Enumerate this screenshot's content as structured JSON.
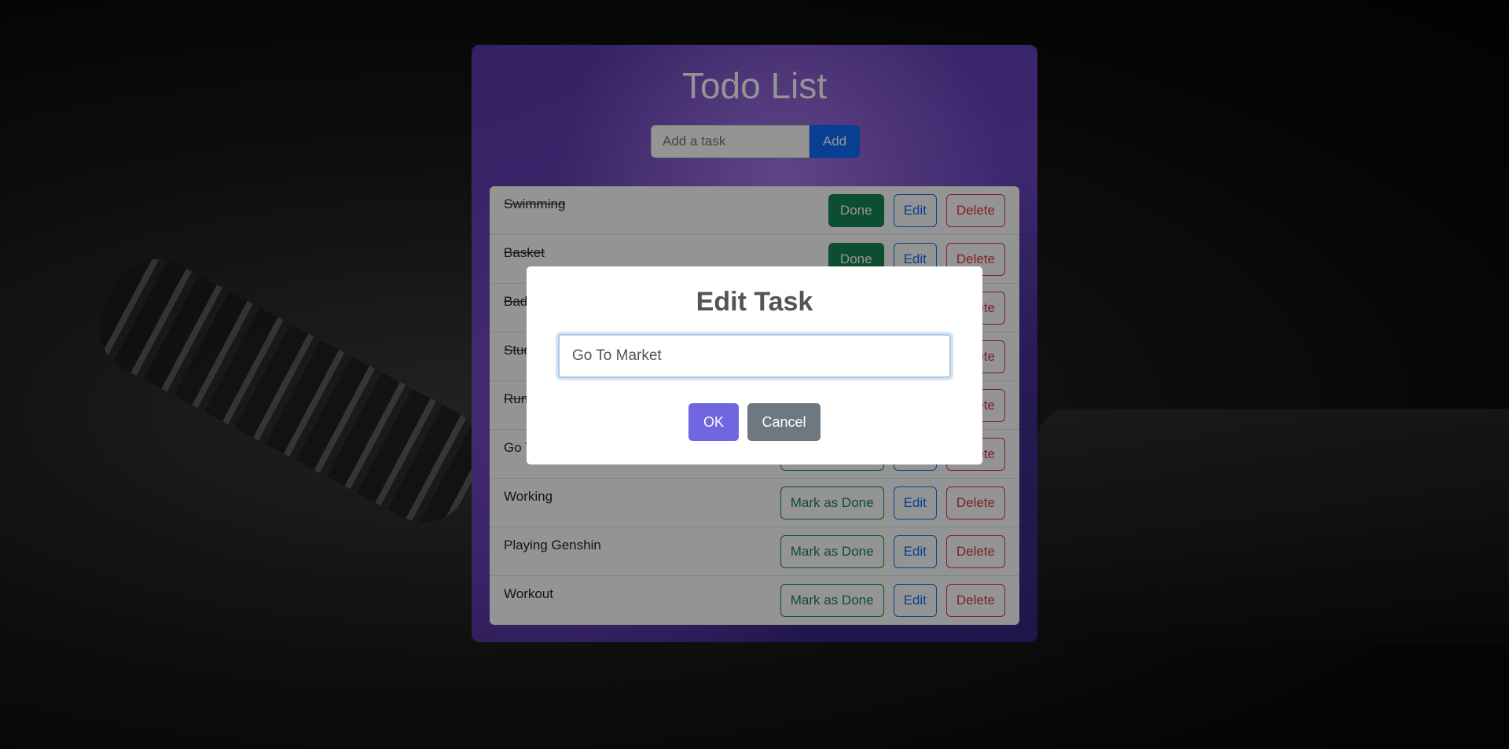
{
  "app": {
    "title": "Todo List",
    "add_placeholder": "Add a task",
    "add_label": "Add"
  },
  "tasks": [
    {
      "text": "Swimming",
      "done": true
    },
    {
      "text": "Basket",
      "done": true
    },
    {
      "text": "Badminton",
      "done": true
    },
    {
      "text": "Study",
      "done": true
    },
    {
      "text": "Running",
      "done": true
    },
    {
      "text": "Go To Market",
      "done": false
    },
    {
      "text": "Working",
      "done": false
    },
    {
      "text": "Playing Genshin",
      "done": false
    },
    {
      "text": "Workout",
      "done": false
    }
  ],
  "labels": {
    "done": "Done",
    "mark_done": "Mark as Done",
    "edit": "Edit",
    "delete": "Delete"
  },
  "modal": {
    "title": "Edit Task",
    "input_value": "Go To Market",
    "ok_label": "OK",
    "cancel_label": "Cancel"
  },
  "colors": {
    "primary": "#0d6efd",
    "success": "#198754",
    "danger": "#dc3545",
    "modal_ok": "#7066e0",
    "modal_cancel": "#6e7881"
  }
}
